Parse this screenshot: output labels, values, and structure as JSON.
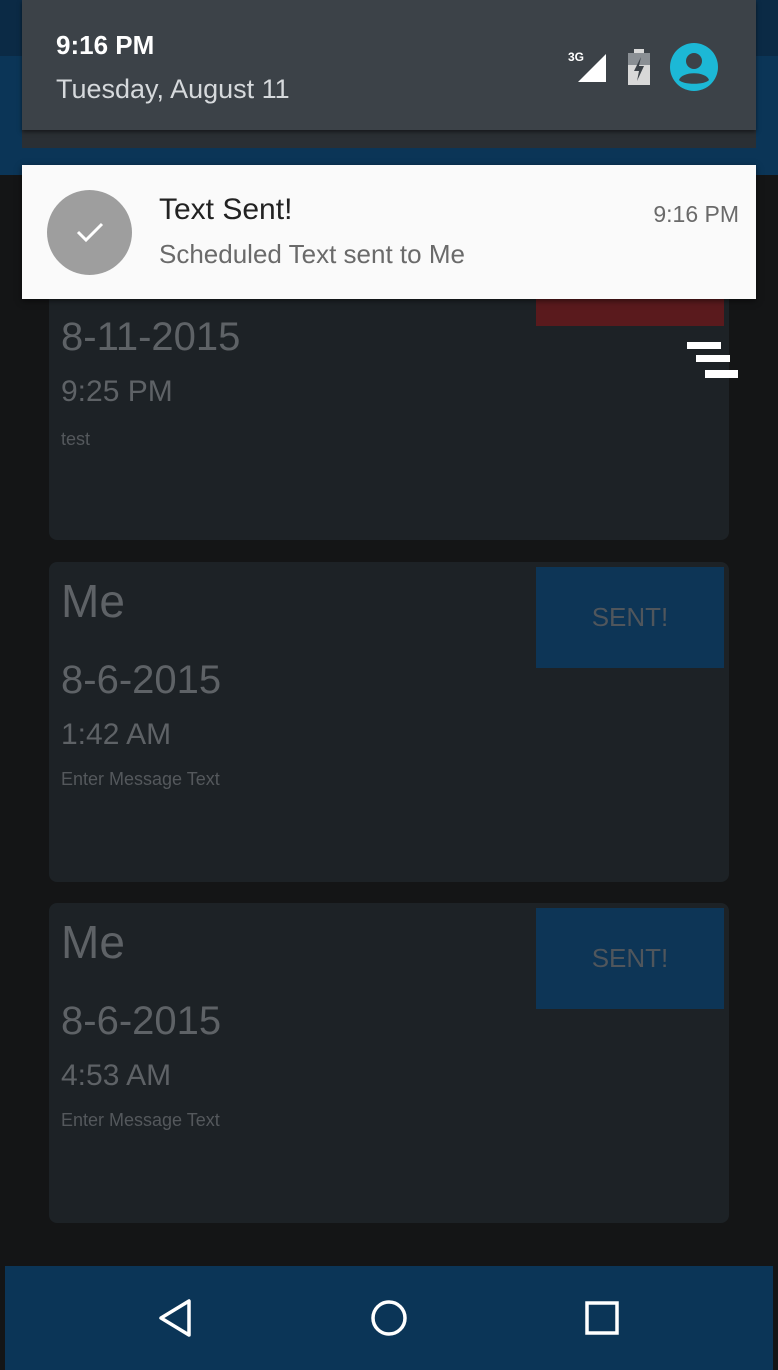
{
  "status_shade": {
    "time": "9:16 PM",
    "date": "Tuesday, August 11",
    "network_label": "3G",
    "icons": [
      "signal-3g-icon",
      "battery-charging-icon",
      "account-avatar-icon"
    ]
  },
  "notification": {
    "icon": "checkmark-icon",
    "title": "Text Sent!",
    "body": "Scheduled Text sent to Me",
    "time": "9:16 PM"
  },
  "cards": [
    {
      "date": "8-11-2015",
      "time": "9:25 PM",
      "message": "test"
    },
    {
      "name": "Me",
      "status_label": "SENT!",
      "date": "8-6-2015",
      "time": "1:42 AM",
      "message": "Enter Message Text"
    },
    {
      "name": "Me",
      "status_label": "SENT!",
      "date": "8-6-2015",
      "time": "4:53 AM",
      "message": "Enter Message Text"
    }
  ],
  "nav_bar": {
    "icons": [
      "back-icon",
      "home-icon",
      "recents-icon"
    ]
  },
  "colors": {
    "app_bar": "#0b3557",
    "card_bg": "#1d2226",
    "sent_button": "#0d3556",
    "pending_button": "#5a1a1d",
    "avatar_accent": "#1cb8d6"
  }
}
